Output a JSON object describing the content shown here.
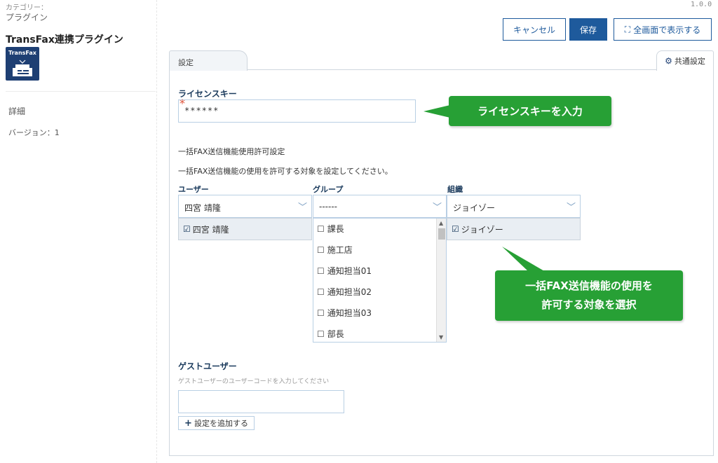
{
  "sidebar": {
    "category_label": "カテゴリー：",
    "category_value": "プラグイン",
    "plugin_title": "TransFax連携プラグイン",
    "logo_text": "TransFax",
    "detail": "詳細",
    "version": "バージョン：1"
  },
  "header": {
    "version": "1.0.0",
    "cancel_label": "キャンセル",
    "save_label": "保存",
    "fullscreen_label": "全画面で表示する"
  },
  "tabs": {
    "settings": "設定",
    "common": "共通設定"
  },
  "license": {
    "label": "ライセンスキー",
    "value": "******"
  },
  "callouts": {
    "license": "ライセンスキーを入力",
    "target_line1": "一括FAX送信機能の使用を",
    "target_line2": "許可する対象を選択"
  },
  "permission": {
    "title": "一括FAX送信機能使用許可設定",
    "description": "一括FAX送信機能の使用を許可する対象を設定してください。",
    "user_label": "ユーザー",
    "group_label": "グループ",
    "org_label": "組織",
    "user_value": "四宮 靖隆",
    "group_value": "------",
    "org_value": "ジョイゾー",
    "user_selected": "四宮 靖隆",
    "org_selected": "ジョイゾー",
    "group_options": [
      "課長",
      "施工店",
      "通知担当01",
      "通知担当02",
      "通知担当03",
      "部長"
    ]
  },
  "guest": {
    "label": "ゲストユーザー",
    "hint": "ゲストユーザーのユーザーコードを入力してください",
    "value": "",
    "add_label": "設定を追加する"
  }
}
